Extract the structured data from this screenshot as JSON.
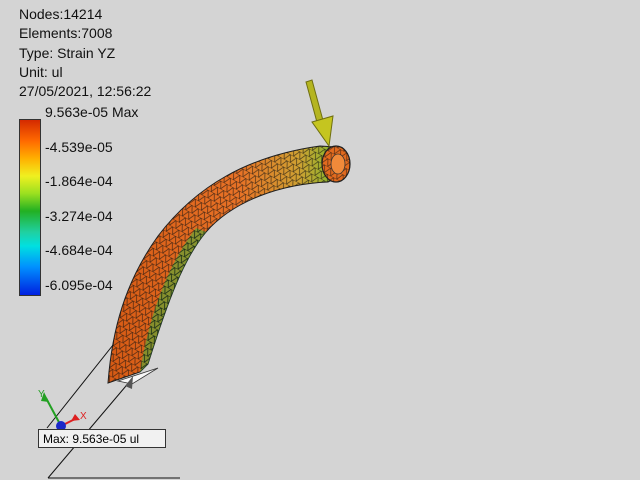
{
  "info": {
    "nodes": "Nodes:14214",
    "elements": "Elements:7008",
    "type": "Type: Strain YZ",
    "unit": "Unit: ul",
    "timestamp": "27/05/2021, 12:56:22"
  },
  "legend": {
    "labels": [
      "9.563e-05 Max",
      "-4.539e-05",
      "-1.864e-04",
      "-3.274e-04",
      "-4.684e-04",
      "-6.095e-04"
    ],
    "colors": {
      "top": "#d42a00",
      "orange": "#ff6a00",
      "yellow": "#f0f020",
      "green": "#22b022",
      "cyan": "#00e0e0",
      "blue": "#0020e0"
    }
  },
  "probe": {
    "max_label": "Max: 9.563e-05 ul"
  },
  "axes": {
    "x_label": "X",
    "y_label": "Y"
  },
  "colors": {
    "background": "#d4d4d4",
    "load_arrow": "#b5b520",
    "mesh_orange": "#e0641a",
    "mesh_lines": "#111111"
  },
  "icons": [
    "load-arrow-icon",
    "axis-triad-icon"
  ]
}
